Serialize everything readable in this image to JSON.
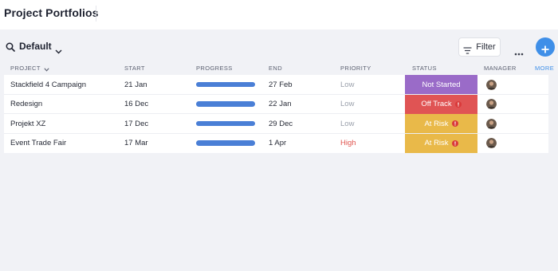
{
  "app": {
    "title": "Project Portfolios"
  },
  "toolbar": {
    "view_label": "Default",
    "filter_label": "Filter"
  },
  "table": {
    "columns": {
      "project": "PROJECT",
      "start": "START",
      "progress": "PROGRESS",
      "end": "END",
      "priority": "PRIORITY",
      "status": "STATUS",
      "manager": "MANAGER",
      "more": "MORE"
    },
    "rows": [
      {
        "project": "Stackfield 4 Campaign",
        "start": "21 Jan",
        "progress": 1.0,
        "end": "27 Feb",
        "priority": "Low",
        "status": "Not Started",
        "status_color": "#9a6bc8",
        "status_alert": false
      },
      {
        "project": "Redesign",
        "start": "16 Dec",
        "progress": 1.0,
        "end": "22 Jan",
        "priority": "Low",
        "status": "Off Track",
        "status_color": "#e05454",
        "status_alert": true
      },
      {
        "project": "Projekt XZ",
        "start": "17 Dec",
        "progress": 1.0,
        "end": "29 Dec",
        "priority": "Low",
        "status": "At Risk",
        "status_color": "#e9b949",
        "status_alert": true
      },
      {
        "project": "Event Trade Fair",
        "start": "17 Mar",
        "progress": 1.0,
        "end": "1 Apr",
        "priority": "High",
        "status": "At Risk",
        "status_color": "#e9b949",
        "status_alert": true
      }
    ]
  },
  "colors": {
    "accent": "#3f8fe8",
    "progress_bar": "#4a7fd6",
    "priority_high": "#e0554f",
    "priority_low": "#9aa0ab",
    "background": "#f1f2f6"
  },
  "icons": {
    "search": "search-icon",
    "view_dropdown": "chevron-down-icon",
    "filter": "filter-icon",
    "more": "more-icon",
    "add": "plus-icon",
    "alert": "alert-icon",
    "avatar": "avatar"
  }
}
